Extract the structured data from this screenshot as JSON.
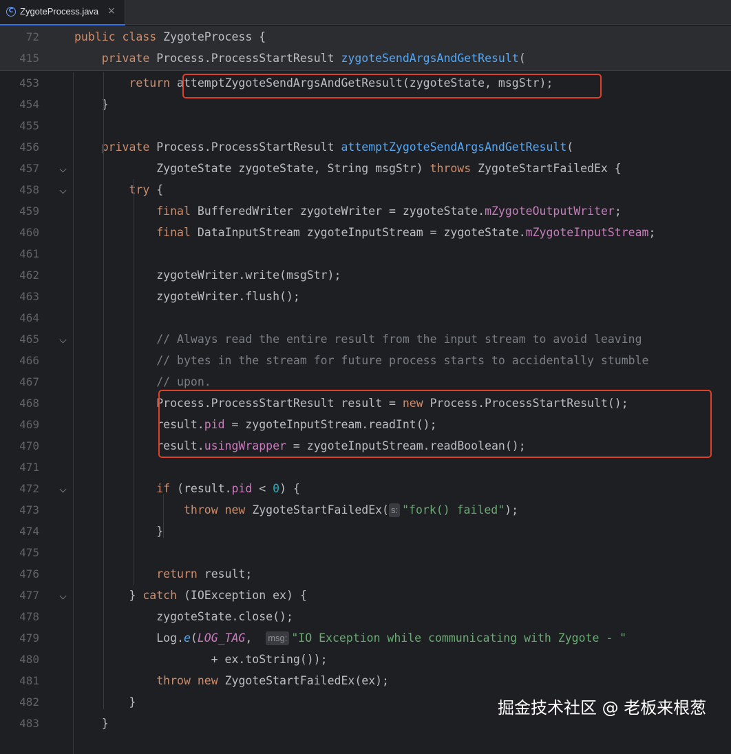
{
  "tab": {
    "filename": "ZygoteProcess.java",
    "icon": "C",
    "close": "×"
  },
  "sticky": [
    {
      "num": "72",
      "tokens": [
        [
          "kw",
          "public "
        ],
        [
          "kw",
          "class "
        ],
        [
          "",
          "ZygoteProcess {"
        ]
      ]
    },
    {
      "num": "415",
      "tokens": [
        [
          "",
          "    "
        ],
        [
          "kw",
          "private "
        ],
        [
          "",
          "Process.ProcessStartResult "
        ],
        [
          "fn",
          "zygoteSendArgsAndGetResult"
        ],
        [
          "",
          "("
        ]
      ]
    }
  ],
  "lines": [
    {
      "num": "453",
      "tokens": [
        [
          "",
          "        "
        ],
        [
          "kw",
          "return "
        ],
        [
          "",
          "attemptZygoteSendArgsAndGetResult(zygoteState, msgStr);"
        ]
      ]
    },
    {
      "num": "454",
      "tokens": [
        [
          "",
          "    }"
        ]
      ]
    },
    {
      "num": "455",
      "tokens": []
    },
    {
      "num": "456",
      "tokens": [
        [
          "",
          "    "
        ],
        [
          "kw",
          "private "
        ],
        [
          "",
          "Process.ProcessStartResult "
        ],
        [
          "fn",
          "attemptZygoteSendArgsAndGetResult"
        ],
        [
          "",
          "("
        ]
      ]
    },
    {
      "num": "457",
      "fold": true,
      "tokens": [
        [
          "",
          "            ZygoteState zygoteState, String msgStr) "
        ],
        [
          "kw",
          "throws "
        ],
        [
          "",
          "ZygoteStartFailedEx {"
        ]
      ]
    },
    {
      "num": "458",
      "fold": true,
      "tokens": [
        [
          "",
          "        "
        ],
        [
          "kw",
          "try "
        ],
        [
          "",
          "{"
        ]
      ]
    },
    {
      "num": "459",
      "tokens": [
        [
          "",
          "            "
        ],
        [
          "kw",
          "final "
        ],
        [
          "",
          "BufferedWriter zygoteWriter = zygoteState."
        ],
        [
          "fld",
          "mZygoteOutputWriter"
        ],
        [
          "",
          ";"
        ]
      ]
    },
    {
      "num": "460",
      "tokens": [
        [
          "",
          "            "
        ],
        [
          "kw",
          "final "
        ],
        [
          "",
          "DataInputStream zygoteInputStream = zygoteState."
        ],
        [
          "fld",
          "mZygoteInputStream"
        ],
        [
          "",
          ";"
        ]
      ]
    },
    {
      "num": "461",
      "tokens": []
    },
    {
      "num": "462",
      "tokens": [
        [
          "",
          "            zygoteWriter.write(msgStr);"
        ]
      ]
    },
    {
      "num": "463",
      "tokens": [
        [
          "",
          "            zygoteWriter.flush();"
        ]
      ]
    },
    {
      "num": "464",
      "tokens": []
    },
    {
      "num": "465",
      "fold": true,
      "tokens": [
        [
          "",
          "            "
        ],
        [
          "cmt",
          "// Always read the entire result from the input stream to avoid leaving"
        ]
      ]
    },
    {
      "num": "466",
      "tokens": [
        [
          "",
          "            "
        ],
        [
          "cmt",
          "// bytes in the stream for future process starts to accidentally stumble"
        ]
      ]
    },
    {
      "num": "467",
      "tokens": [
        [
          "",
          "            "
        ],
        [
          "cmt",
          "// upon."
        ]
      ]
    },
    {
      "num": "468",
      "tokens": [
        [
          "",
          "            Process.ProcessStartResult result = "
        ],
        [
          "kw",
          "new "
        ],
        [
          "",
          "Process.ProcessStartResult();"
        ]
      ]
    },
    {
      "num": "469",
      "tokens": [
        [
          "",
          "            result."
        ],
        [
          "fld",
          "pid"
        ],
        [
          "",
          " = zygoteInputStream.readInt();"
        ]
      ]
    },
    {
      "num": "470",
      "tokens": [
        [
          "",
          "            result."
        ],
        [
          "fld",
          "usingWrapper"
        ],
        [
          "",
          " = zygoteInputStream.readBoolean();"
        ]
      ]
    },
    {
      "num": "471",
      "tokens": []
    },
    {
      "num": "472",
      "fold": true,
      "tokens": [
        [
          "",
          "            "
        ],
        [
          "kw",
          "if "
        ],
        [
          "",
          "(result."
        ],
        [
          "fld",
          "pid"
        ],
        [
          "",
          " < "
        ],
        [
          "num",
          "0"
        ],
        [
          "",
          ") {"
        ]
      ]
    },
    {
      "num": "473",
      "tokens": [
        [
          "",
          "                "
        ],
        [
          "kw",
          "throw "
        ],
        [
          "kw",
          "new "
        ],
        [
          "",
          "ZygoteStartFailedEx("
        ],
        [
          "hint",
          "s:"
        ],
        [
          "str",
          "\"fork() failed\""
        ],
        [
          "",
          ");"
        ]
      ]
    },
    {
      "num": "474",
      "tokens": [
        [
          "",
          "            }"
        ]
      ]
    },
    {
      "num": "475",
      "tokens": []
    },
    {
      "num": "476",
      "tokens": [
        [
          "",
          "            "
        ],
        [
          "kw",
          "return "
        ],
        [
          "",
          "result;"
        ]
      ]
    },
    {
      "num": "477",
      "fold": true,
      "tokens": [
        [
          "",
          "        } "
        ],
        [
          "kw",
          "catch "
        ],
        [
          "",
          "(IOException ex) {"
        ]
      ]
    },
    {
      "num": "478",
      "tokens": [
        [
          "",
          "            zygoteState.close();"
        ]
      ]
    },
    {
      "num": "479",
      "tokens": [
        [
          "",
          "            Log."
        ],
        [
          "fn ital",
          "e"
        ],
        [
          "",
          "("
        ],
        [
          "fld ital",
          "LOG_TAG"
        ],
        [
          "",
          ",  "
        ],
        [
          "hint",
          "msg:"
        ],
        [
          "str",
          "\"IO Exception while communicating with Zygote - \""
        ]
      ]
    },
    {
      "num": "480",
      "tokens": [
        [
          "",
          "                    + ex.toString());"
        ]
      ]
    },
    {
      "num": "481",
      "tokens": [
        [
          "",
          "            "
        ],
        [
          "kw",
          "throw "
        ],
        [
          "kw",
          "new "
        ],
        [
          "",
          "ZygoteStartFailedEx(ex);"
        ]
      ]
    },
    {
      "num": "482",
      "tokens": [
        [
          "",
          "        }"
        ]
      ]
    },
    {
      "num": "483",
      "tokens": [
        [
          "",
          "    }"
        ]
      ]
    }
  ],
  "watermark": "掘金技术社区 @ 老板来根葱",
  "colors": {
    "background": "#1e1f22",
    "keyword": "#cf8e6d",
    "method": "#56a8f5",
    "field": "#c77dbb",
    "number": "#2aacb8",
    "string": "#6aab73",
    "comment": "#7a7e85",
    "highlight_box": "#e0402a"
  }
}
